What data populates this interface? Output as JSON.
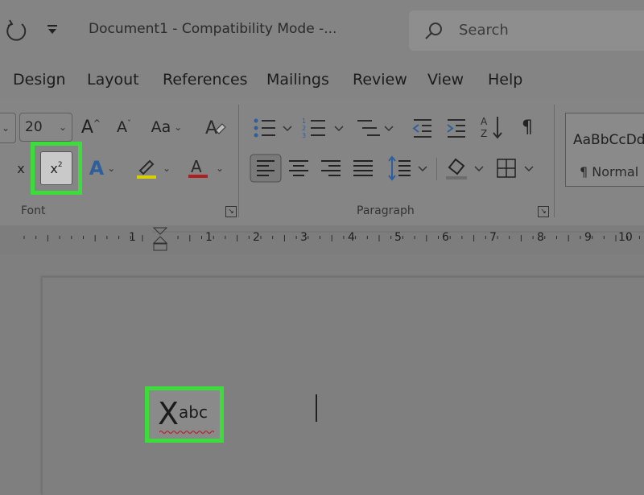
{
  "title_bar": {
    "document_title": "Document1  -  Compatibility Mode  -...",
    "search_placeholder": "Search"
  },
  "menu": {
    "tabs": [
      "Design",
      "Layout",
      "References",
      "Mailings",
      "Review",
      "View",
      "Help"
    ]
  },
  "ribbon": {
    "font_group": {
      "label": "Font",
      "font_size": "20",
      "change_case_label": "Aa",
      "superscript_label": "x",
      "superscript_exponent": "2",
      "subscript_partial_label": "x"
    },
    "paragraph_group": {
      "label": "Paragraph",
      "pilcrow": "¶"
    },
    "styles_group": {
      "preview_text": "AaBbCcDd",
      "normal_label": "¶ Normal"
    }
  },
  "ruler": {
    "numbers": [
      "1",
      "1",
      "2",
      "3",
      "4",
      "5",
      "6",
      "7",
      "8",
      "9",
      "10"
    ]
  },
  "document": {
    "base_text": "X",
    "superscript_text": "abc"
  },
  "colors": {
    "highlight": "#3cdc3c",
    "font_color_bar": "#b01e1e",
    "highlighter_bar": "#d8d000",
    "text_effects": "#2f5f9a"
  }
}
